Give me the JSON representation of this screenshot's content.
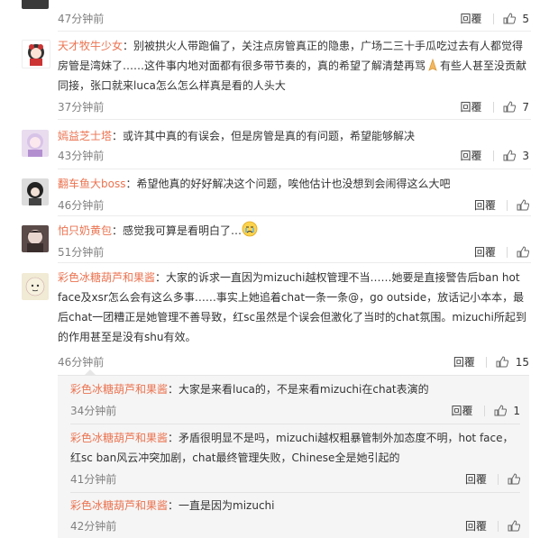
{
  "actions": {
    "reply_label": "回覆",
    "report_icon": "report-icon",
    "like_icon": "thumbs-up-icon"
  },
  "comments": [
    {
      "time": "47分钟前",
      "likes": "5"
    },
    {
      "user": "天才牧牛少女",
      "text": "：别被拱火人带跑偏了，关注点房管真正的隐患，广场二三十手瓜吃过去有人都觉得房管是湾妹了……这件事内地对面都有很多带节奏的，真的希望了解清楚再骂",
      "text2": "有些人甚至没贡献同接，张口就来luca怎么怎么样真是看的人头大",
      "time": "37分钟前",
      "likes": "7"
    },
    {
      "user": "嫣益芝士塔",
      "text": "：或许其中真的有误会，但是房管是真的有问题，希望能够解决",
      "time": "43分钟前",
      "likes": "3"
    },
    {
      "user": "翻车鱼大boss",
      "text": "：希望他真的好好解决这个问题，唉他估计也没想到会闹得这么大吧",
      "time": "46分钟前"
    },
    {
      "user": "怕只奶黄包",
      "text": "：感觉我可算是看明白了…",
      "time": "51分钟前"
    },
    {
      "user": "彩色冰糖葫芦和果酱",
      "text": "：大家的诉求一直因为mizuchi越权管理不当……她要是直接警告后ban hot face及xsr怎么会有这么多事……事实上她追着chat一条一条@，go outside，放话记小本本，最后chat一团糟正是她管理不善导致，红sc虽然是个误会但激化了当时的chat氛围。mizuchi所起到的作用甚至是没有shu有效。",
      "time": "46分钟前",
      "likes": "15"
    }
  ],
  "replies": [
    {
      "user": "彩色冰糖葫芦和果酱",
      "text": "：大家是来看luca的，不是来看mizuchi在chat表演的",
      "time": "34分钟前",
      "likes": "1"
    },
    {
      "user": "彩色冰糖葫芦和果酱",
      "text": "：矛盾很明显不是吗，mizuchi越权粗暴管制外加态度不明，hot face，红sc ban风云冲突加剧，chat最终管理失败，Chinese全是她引起的",
      "time": "41分钟前"
    },
    {
      "user": "彩色冰糖葫芦和果酱",
      "text": "：一直是因为mizuchi",
      "time": "42分钟前"
    }
  ]
}
